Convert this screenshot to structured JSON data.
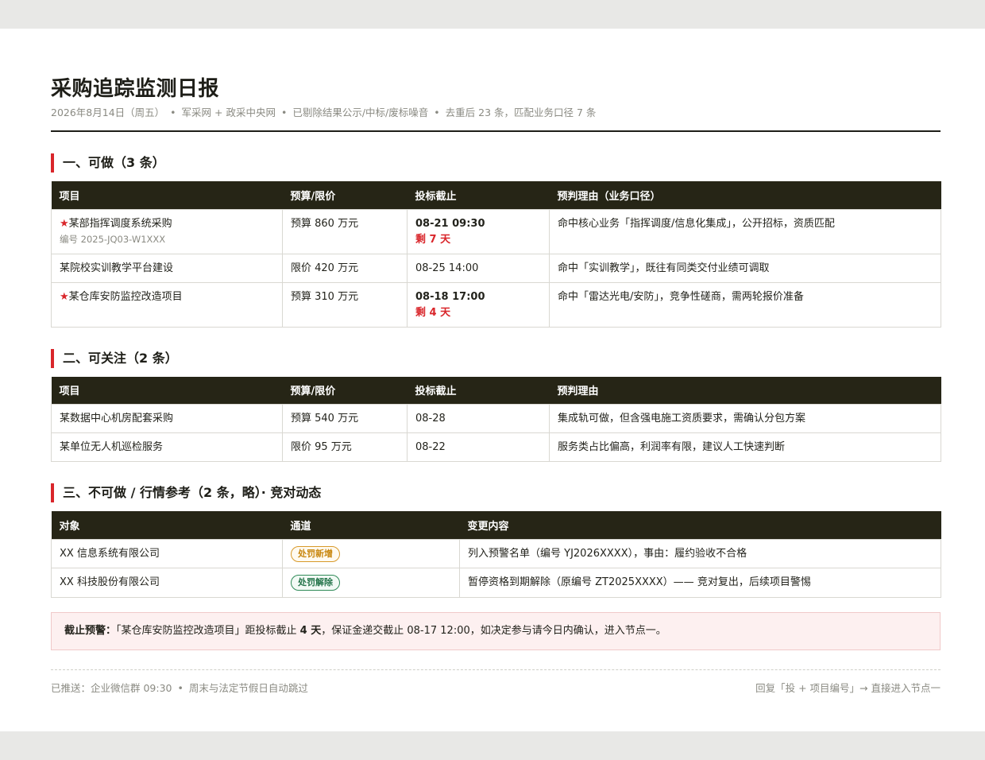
{
  "header": {
    "title": "采购追踪监测日报",
    "meta": [
      "2026年8月14日（周五）",
      "军采网 + 政采中央网",
      "已剔除结果公示/中标/废标噪音",
      "去重后 23 条，匹配业务口径 7 条"
    ],
    "separator": "•"
  },
  "section1": {
    "title": "一、可做（3 条）",
    "columns": [
      "项目",
      "预算/限价",
      "投标截止",
      "预判理由（业务口径）"
    ],
    "rows": [
      {
        "star": "★",
        "name": "某部指挥调度系统采购",
        "code": "编号 2025-JQ03-W1XXX",
        "budget": "预算 860 万元",
        "deadline": "08-21 09:30",
        "remain": "剩 7 天",
        "reason": "命中核心业务「指挥调度/信息化集成」，公开招标，资质匹配"
      },
      {
        "star": "",
        "name": "某院校实训教学平台建设",
        "code": "",
        "budget": "限价 420 万元",
        "deadline": "08-25 14:00",
        "remain": "",
        "reason": "命中「实训教学」，既往有同类交付业绩可调取"
      },
      {
        "star": "★",
        "name": "某仓库安防监控改造项目",
        "code": "",
        "budget": "预算 310 万元",
        "deadline": "08-18 17:00",
        "remain": "剩 4 天",
        "reason": "命中「雷达光电/安防」，竞争性磋商，需两轮报价准备"
      }
    ]
  },
  "section2": {
    "title": "二、可关注（2 条）",
    "columns": [
      "项目",
      "预算/限价",
      "投标截止",
      "预判理由"
    ],
    "rows": [
      {
        "name": "某数据中心机房配套采购",
        "budget": "预算 540 万元",
        "deadline": "08-28",
        "reason": "集成轨可做，但含强电施工资质要求，需确认分包方案"
      },
      {
        "name": "某单位无人机巡检服务",
        "budget": "限价 95 万元",
        "deadline": "08-22",
        "reason": "服务类占比偏高，利润率有限，建议人工快速判断"
      }
    ]
  },
  "section3": {
    "title": "三、不可做 / 行情参考（2 条，略）· 竞对动态",
    "columns": [
      "对象",
      "通道",
      "变更内容"
    ],
    "rows": [
      {
        "target": "XX 信息系统有限公司",
        "channel": "处罚新增",
        "channel_color": "#c8860d",
        "change": "列入预警名单（编号 YJ2026XXXX），事由：履约验收不合格"
      },
      {
        "target": "XX 科技股份有限公司",
        "channel": "处罚解除",
        "channel_color": "#24744a",
        "change": "暂停资格到期解除（原编号 ZT2025XXXX）—— 竞对复出，后续项目警惕"
      }
    ]
  },
  "alert": {
    "label": "截止预警：",
    "text1": "「某仓库安防监控改造项目」距投标截止 ",
    "days": "4 天",
    "text2": "，保证金递交截止 08-17 12:00，如决定参与请今日内确认，进入节点一。"
  },
  "footer": {
    "left1": "已推送：企业微信群 09:30",
    "left2": "周末与法定节假日自动跳过",
    "right": "回复「投 + 项目编号」→ 直接进入节点一"
  }
}
